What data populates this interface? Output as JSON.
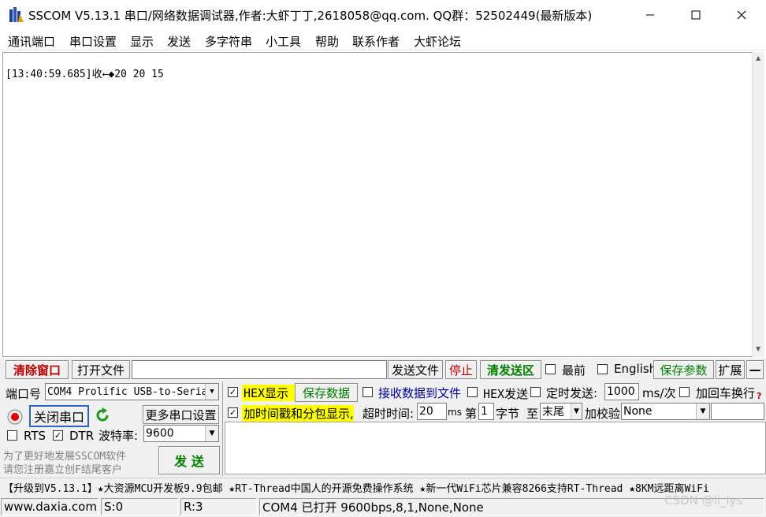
{
  "window": {
    "title": "SSCOM V5.13.1 串口/网络数据调试器,作者:大虾丁丁,2618058@qq.com. QQ群：52502449(最新版本)",
    "minimize": "—",
    "maximize": "☐",
    "close": "✕"
  },
  "menu": [
    "通讯端口",
    "串口设置",
    "显示",
    "发送",
    "多字符串",
    "小工具",
    "帮助",
    "联系作者",
    "大虾论坛"
  ],
  "receive": {
    "line": "[13:40:59.685]收←◆20 20 15"
  },
  "toolbar": {
    "clear_window": "清除窗口",
    "open_file": "打开文件",
    "file_path": "",
    "send_file": "发送文件",
    "stop": "停止",
    "clear_send_area": "清发送区",
    "topmost_label": "最前",
    "english_label": "English",
    "save_params": "保存参数",
    "expand": "扩展",
    "collapse": "—"
  },
  "port": {
    "port_label": "端口号",
    "port_value": "COM4 Prolific USB-to-Seria",
    "close_port": "关闭串口",
    "more_settings": "更多串口设置",
    "rts_label": "RTS",
    "dtr_label": "DTR",
    "baud_label": "波特率:",
    "baud_value": "9600",
    "promo_line1": "为了更好地发展SSCOM软件",
    "promo_line2": "请您注册嘉立创F结尾客户",
    "send_button": "发 送"
  },
  "options": {
    "hex_display": "HEX显示",
    "save_data": "保存数据",
    "recv_to_file": "接收数据到文件",
    "hex_send": "HEX发送",
    "timed_send": "定时发送:",
    "interval": "1000",
    "interval_unit": "ms/次",
    "add_crlf": "加回车换行",
    "timestamp_split": "加时间戳和分包显示,",
    "timeout_label": "超时时间:",
    "timeout_value": "20",
    "timeout_unit": "ms",
    "byte_prefix": "第",
    "byte_index": "1",
    "byte_suffix": "字节",
    "to_label": "至",
    "to_value": "末尾",
    "checksum_label": "加校验",
    "checksum_value": "None",
    "help_mark": "?"
  },
  "ticker": "【升级到V5.13.1】★大资源MCU开发板9.9包邮 ★RT-Thread中国人的开源免费操作系统 ★新一代WiFi芯片兼容8266支持RT-Thread ★8KM远距离WiFi",
  "status": {
    "website": "www.daxia.com",
    "sent": "S:0",
    "received": "R:3",
    "port_state": "COM4 已打开  9600bps,8,1,None,None"
  },
  "watermark": "CSDN @li_lys",
  "colors": {
    "accent_red": "#c00000",
    "accent_green": "#008000",
    "highlight": "#ffff00"
  }
}
